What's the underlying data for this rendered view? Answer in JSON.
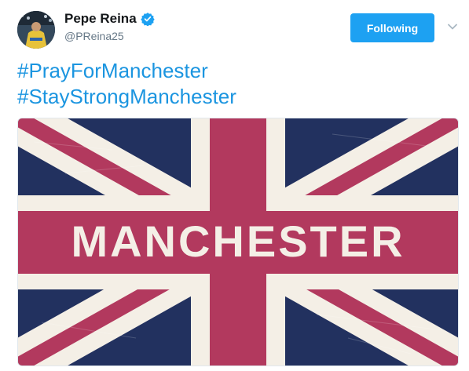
{
  "tweet": {
    "author": {
      "name": "Pepe Reina",
      "handle": "@PReina25",
      "verified": true
    },
    "follow_button_label": "Following",
    "text_lines": [
      "#PrayForManchester",
      "#StayStrongManchester"
    ],
    "image": {
      "caption_text": "MANCHESTER"
    }
  },
  "colors": {
    "accent": "#1da1f2",
    "hashtag": "#1b95e0",
    "flag_blue": "#22315f",
    "flag_red": "#b2395e",
    "flag_white": "#f4efe6"
  },
  "icons": {
    "verified": "verified-badge-icon",
    "caret": "chevron-down-icon"
  }
}
